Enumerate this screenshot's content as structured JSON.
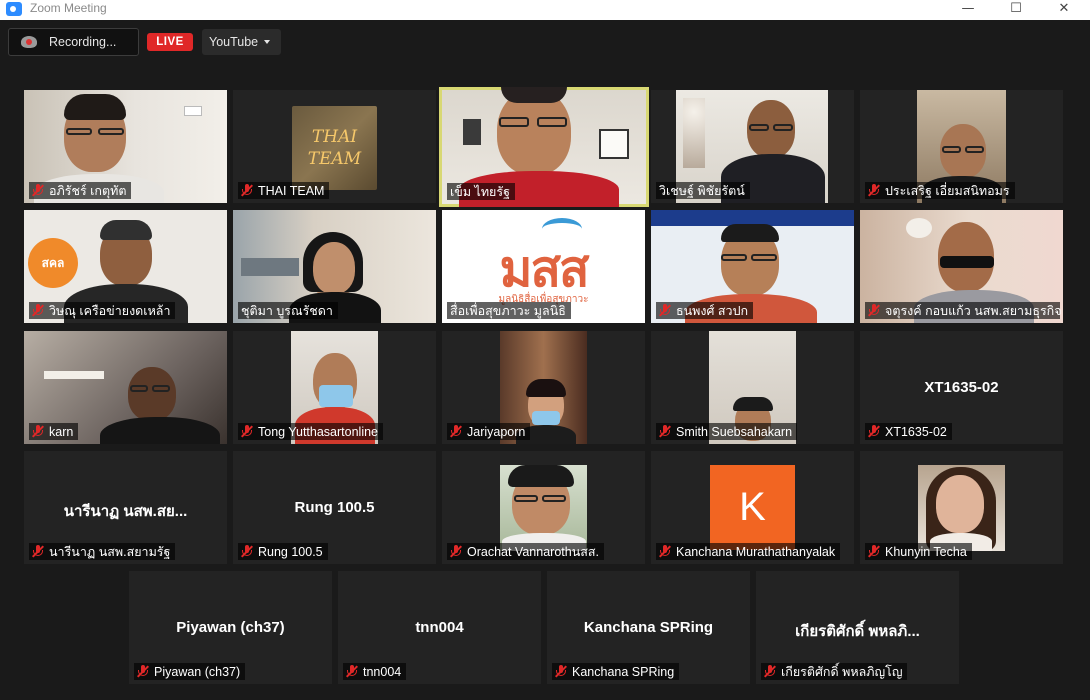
{
  "window": {
    "title": "Zoom Meeting",
    "minimize": "—",
    "maximize": "☐",
    "close": "✕"
  },
  "topbar": {
    "recording_label": "Recording...",
    "live_label": "LIVE",
    "stream_target": "YouTube"
  },
  "participants": [
    {
      "name": "อภิรัชร์ เกตุทัต",
      "video": true
    },
    {
      "name": "THAI TEAM",
      "video": true,
      "logo_text": "THAI TEAM"
    },
    {
      "name": "เข็ม ไทยรัฐ",
      "video": true,
      "active_speaker": true
    },
    {
      "name": "วิเชษฐ์ พิชัยรัตน์",
      "video": true
    },
    {
      "name": "ประเสริฐ เอี่ยมสนิทอมร",
      "video": true
    },
    {
      "name": "วิษณุ เครือข่ายงดเหล้า",
      "video": true,
      "badge_text": "สคล"
    },
    {
      "name": "ชุติมา บูรณรัชดา",
      "video": true
    },
    {
      "name": "สื่อเพื่อสุขภาวะ มูลนิธิ",
      "video": true,
      "logo_text": "มสส",
      "logo_sub": "มูลนิธิสื่อเพื่อสุขภาวะ"
    },
    {
      "name": "ธนพงศ์ สวปก",
      "video": true
    },
    {
      "name": "จตุรงค์ กอบแก้ว นสพ.สยามธุรกิจ",
      "video": true
    },
    {
      "name": "karn",
      "video": true
    },
    {
      "name": "Tong Yutthasartonline",
      "video": true
    },
    {
      "name": "Jariyaporn",
      "video": true
    },
    {
      "name": "Smith Suebsahakarn",
      "video": true
    },
    {
      "name": "XT1635-02",
      "video": false,
      "display_name": "XT1635-02"
    },
    {
      "name": "นารีนาฏ นสพ.สยามรัฐ",
      "video": false,
      "display_name": "นารีนาฏ นสพ.สย..."
    },
    {
      "name": "Rung 100.5",
      "video": false,
      "display_name": "Rung 100.5"
    },
    {
      "name": "Orachat Vannarothนสส.",
      "video": true
    },
    {
      "name": "Kanchana Murathathanyalak",
      "video": true,
      "avatar_letter": "K"
    },
    {
      "name": "Khunyin Techa",
      "video": true
    },
    {
      "name": "Piyawan (ch37)",
      "video": false,
      "display_name": "Piyawan (ch37)"
    },
    {
      "name": "tnn004",
      "video": false,
      "display_name": "tnn004"
    },
    {
      "name": "Kanchana SPRing",
      "video": false,
      "display_name": "Kanchana SPRing"
    },
    {
      "name": "เกียรติศักดิ์ พหลภิญโญ",
      "video": false,
      "display_name": "เกียรติศักดิ์ พหลภิ..."
    }
  ],
  "colors": {
    "active_border": "#d8d873",
    "muted_mic": "#e02828",
    "live": "#e02828",
    "kanchana_avatar": "#f26522"
  }
}
